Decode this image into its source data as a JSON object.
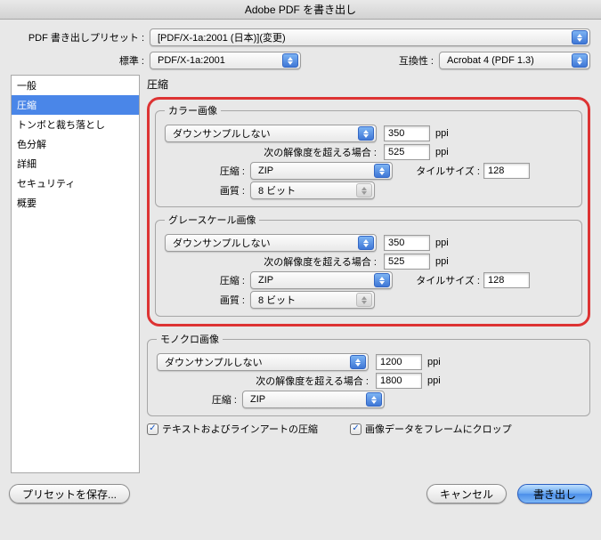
{
  "window": {
    "title": "Adobe PDF を書き出し"
  },
  "preset": {
    "label": "PDF 書き出しプリセット :",
    "value": "[PDF/X-1a:2001 (日本)](変更)"
  },
  "standard": {
    "label": "標準 :",
    "value": "PDF/X-1a:2001"
  },
  "compat": {
    "label": "互換性 :",
    "value": "Acrobat 4 (PDF 1.3)"
  },
  "sidebar": {
    "items": [
      "一般",
      "圧縮",
      "トンボと裁ち落とし",
      "色分解",
      "詳細",
      "セキュリティ",
      "概要"
    ],
    "selected_index": 1
  },
  "panel_title": "圧縮",
  "sections": {
    "color": {
      "legend": "カラー画像",
      "downsample": "ダウンサンプルしない",
      "ppi": "350",
      "ppi_unit": "ppi",
      "threshold_label": "次の解像度を超える場合 :",
      "threshold": "525",
      "compress_label": "圧縮 :",
      "compress": "ZIP",
      "tile_label": "タイルサイズ :",
      "tile": "128",
      "quality_label": "画質 :",
      "quality": "8 ビット"
    },
    "gray": {
      "legend": "グレースケール画像",
      "downsample": "ダウンサンプルしない",
      "ppi": "350",
      "ppi_unit": "ppi",
      "threshold_label": "次の解像度を超える場合 :",
      "threshold": "525",
      "compress_label": "圧縮 :",
      "compress": "ZIP",
      "tile_label": "タイルサイズ :",
      "tile": "128",
      "quality_label": "画質 :",
      "quality": "8 ビット"
    },
    "mono": {
      "legend": "モノクロ画像",
      "downsample": "ダウンサンプルしない",
      "ppi": "1200",
      "ppi_unit": "ppi",
      "threshold_label": "次の解像度を超える場合 :",
      "threshold": "1800",
      "compress_label": "圧縮 :",
      "compress": "ZIP"
    }
  },
  "checkboxes": {
    "text_lineart": "テキストおよびラインアートの圧縮",
    "crop_frames": "画像データをフレームにクロップ"
  },
  "buttons": {
    "save_preset": "プリセットを保存...",
    "cancel": "キャンセル",
    "export": "書き出し"
  }
}
